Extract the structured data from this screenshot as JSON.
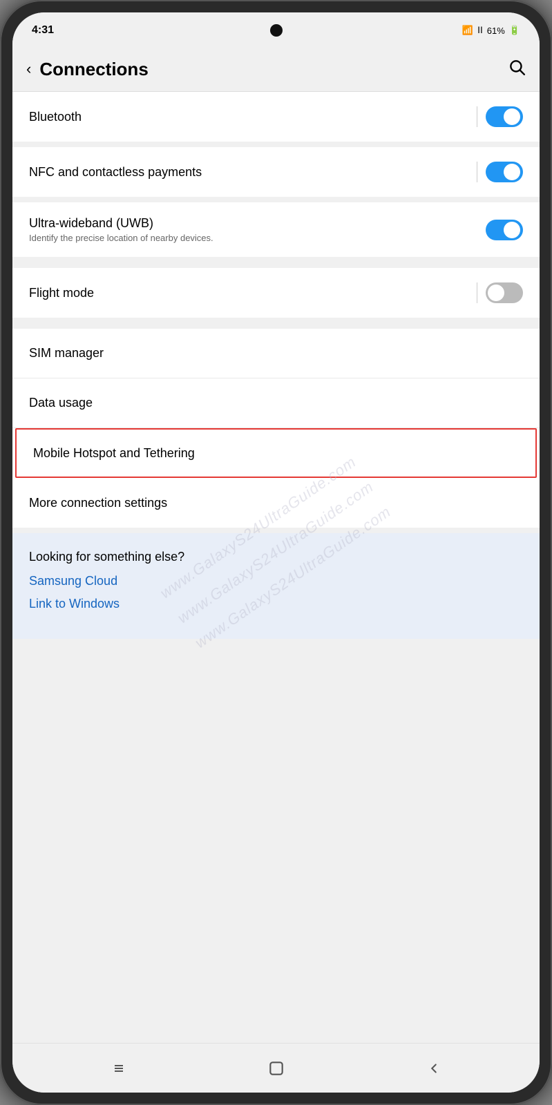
{
  "status_bar": {
    "time": "4:31",
    "battery_percent": "61%",
    "wifi": "wifi",
    "signal": "signal"
  },
  "header": {
    "back_label": "‹",
    "title": "Connections",
    "search_label": "🔍"
  },
  "settings": {
    "items": [
      {
        "id": "bluetooth",
        "title": "Bluetooth",
        "subtitle": "",
        "toggle": true,
        "toggle_state": "on",
        "has_divider": true,
        "highlighted": false
      },
      {
        "id": "nfc",
        "title": "NFC and contactless payments",
        "subtitle": "",
        "toggle": true,
        "toggle_state": "on",
        "has_divider": true,
        "highlighted": false
      },
      {
        "id": "uwb",
        "title": "Ultra-wideband (UWB)",
        "subtitle": "Identify the precise location of nearby devices.",
        "toggle": true,
        "toggle_state": "on",
        "has_divider": false,
        "highlighted": false
      },
      {
        "id": "flight_mode",
        "title": "Flight mode",
        "subtitle": "",
        "toggle": true,
        "toggle_state": "off",
        "has_divider": true,
        "highlighted": false
      },
      {
        "id": "sim_manager",
        "title": "SIM manager",
        "subtitle": "",
        "toggle": false,
        "highlighted": false
      },
      {
        "id": "data_usage",
        "title": "Data usage",
        "subtitle": "",
        "toggle": false,
        "highlighted": false
      },
      {
        "id": "mobile_hotspot",
        "title": "Mobile Hotspot and Tethering",
        "subtitle": "",
        "toggle": false,
        "highlighted": true
      },
      {
        "id": "more_connections",
        "title": "More connection settings",
        "subtitle": "",
        "toggle": false,
        "highlighted": false
      }
    ]
  },
  "suggestion": {
    "title": "Looking for something else?",
    "links": [
      "Samsung Cloud",
      "Link to Windows"
    ]
  },
  "nav_bar": {
    "recent_label": "|||",
    "home_label": "○",
    "back_label": "‹"
  },
  "watermark": "www.GalaxyS24UltraGuide.com"
}
